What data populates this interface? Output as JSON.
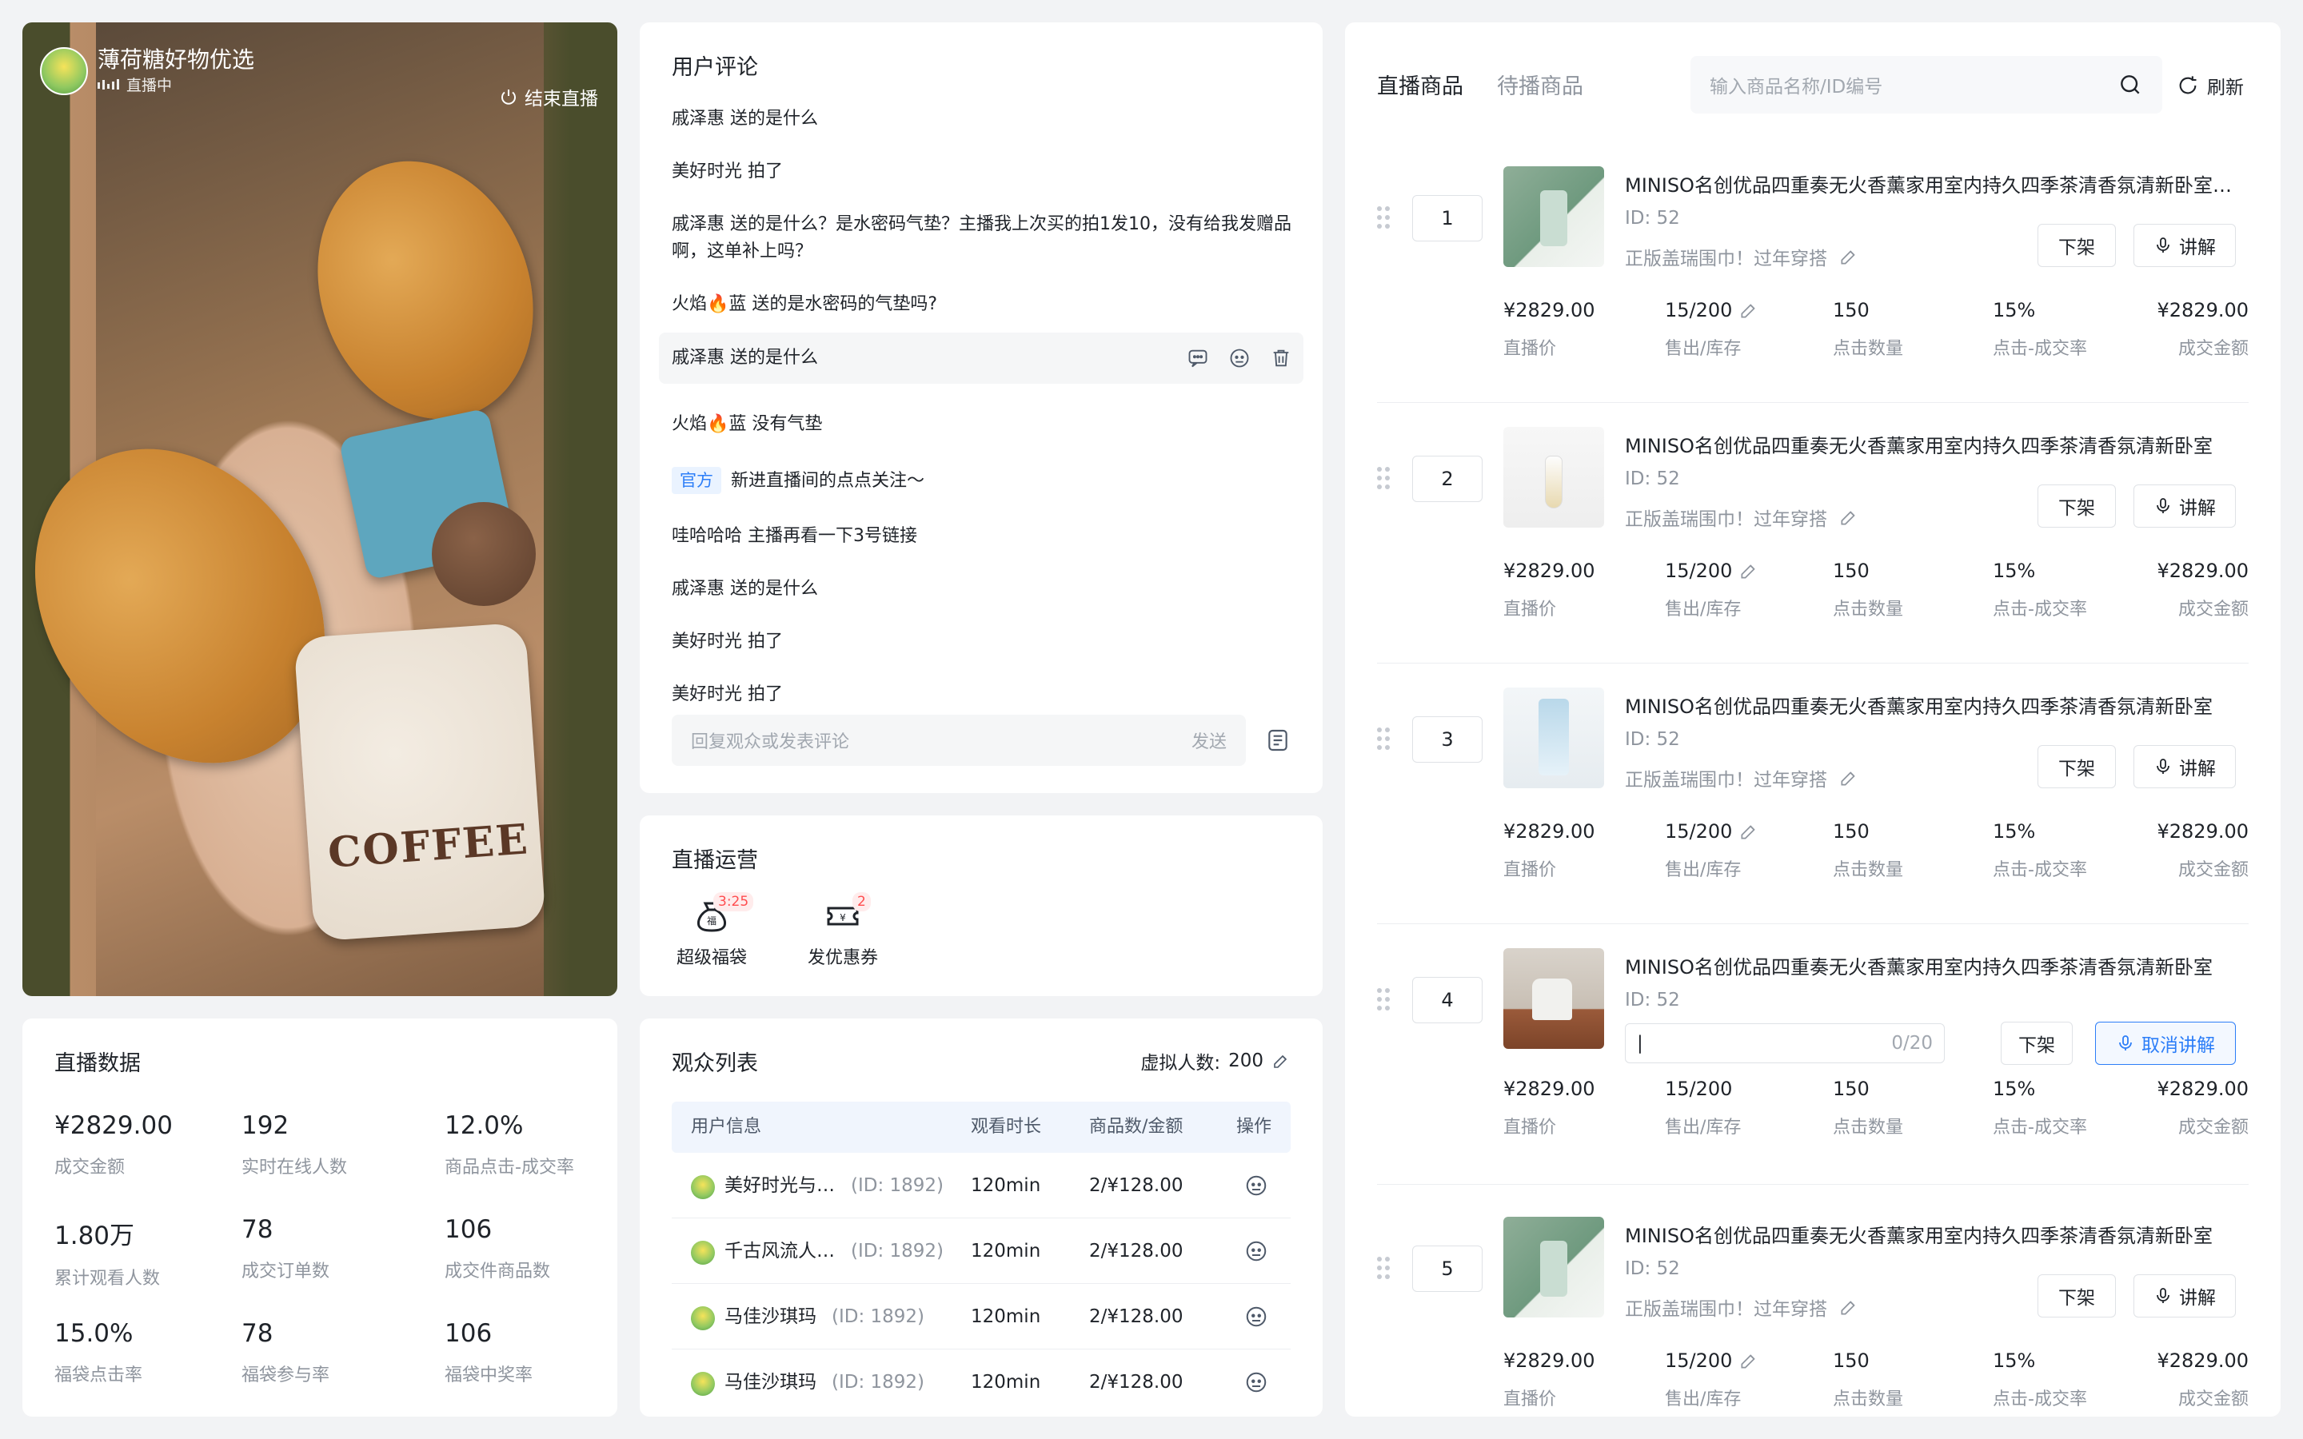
{
  "live": {
    "room_name": "薄荷糖好物优选",
    "status": "直播中",
    "end_label": "结束直播",
    "overlay_text": "COFFEE"
  },
  "live_data": {
    "title": "直播数据",
    "stats": [
      {
        "value": "¥2829.00",
        "label": "成交金额"
      },
      {
        "value": "192",
        "label": "实时在线人数"
      },
      {
        "value": "12.0%",
        "label": "商品点击-成交率"
      },
      {
        "value": "1.80万",
        "label": "累计观看人数"
      },
      {
        "value": "78",
        "label": "成交订单数"
      },
      {
        "value": "106",
        "label": "成交件商品数"
      },
      {
        "value": "15.0%",
        "label": "福袋点击率"
      },
      {
        "value": "78",
        "label": "福袋参与率"
      },
      {
        "value": "106",
        "label": "福袋中奖率"
      }
    ]
  },
  "comments": {
    "title": "用户评论",
    "items": [
      {
        "user": "戚泽惠",
        "text": "送的是什么"
      },
      {
        "user": "美好时光",
        "text": "拍了"
      },
      {
        "user": "戚泽惠",
        "text": "送的是什么？是水密码气垫？主播我上次买的拍1发10，没有给我发赠品啊，这单补上吗？"
      },
      {
        "user": "火焰🔥蓝",
        "text": "送的是水密码的气垫吗?"
      },
      {
        "user": "戚泽惠",
        "text": "送的是什么"
      },
      {
        "user": "火焰🔥蓝",
        "text": "没有气垫"
      },
      {
        "user": "官方",
        "text": "新进直播间的点点关注～"
      },
      {
        "user": "哇哈哈哈",
        "text": "主播再看一下3号链接"
      },
      {
        "user": "戚泽惠",
        "text": "送的是什么"
      },
      {
        "user": "美好时光",
        "text": "拍了"
      },
      {
        "user": "美好时光",
        "text": "拍了"
      }
    ],
    "reply_placeholder": "回复观众或发表评论",
    "send_label": "发送"
  },
  "operations": {
    "title": "直播运营",
    "items": [
      {
        "label": "超级福袋",
        "badge": "3:25"
      },
      {
        "label": "发优惠券",
        "badge": "2"
      }
    ]
  },
  "audience": {
    "title": "观众列表",
    "virtual_label": "虚拟人数:",
    "virtual_count": "200",
    "columns": [
      "用户信息",
      "观看时长",
      "商品数/金额",
      "操作"
    ],
    "rows": [
      {
        "name": "美好时光与…",
        "id": "(ID: 1892)",
        "duration": "120min",
        "amount": "2/¥128.00"
      },
      {
        "name": "千古风流人…",
        "id": "(ID: 1892)",
        "duration": "120min",
        "amount": "2/¥128.00"
      },
      {
        "name": "马佳沙琪玛",
        "id": "(ID: 1892)",
        "duration": "120min",
        "amount": "2/¥128.00"
      },
      {
        "name": "马佳沙琪玛",
        "id": "(ID: 1892)",
        "duration": "120min",
        "amount": "2/¥128.00"
      }
    ]
  },
  "products": {
    "tabs": [
      "直播商品",
      "待播商品"
    ],
    "search_placeholder": "输入商品名称/ID编号",
    "refresh_label": "刷新",
    "delist_label": "下架",
    "explain_label": "讲解",
    "cancel_explain_label": "取消讲解",
    "input_counter": "0/20",
    "metric_labels": [
      "直播价",
      "售出/库存",
      "点击数量",
      "点击-成交率",
      "成交金额"
    ],
    "items": [
      {
        "index": "1",
        "name": "MINISO名创优品四重奏无火香薰家用室内持久四季茶清香氛清新卧室四…",
        "id": "ID:  52",
        "desc": "正版盖瑞围巾！过年穿搭",
        "price": "¥2829.00",
        "stock": "15/200",
        "clicks": "150",
        "rate": "15%",
        "revenue": "¥2829.00"
      },
      {
        "index": "2",
        "name": "MINISO名创优品四重奏无火香薰家用室内持久四季茶清香氛清新卧室",
        "id": "ID:  52",
        "desc": "正版盖瑞围巾！过年穿搭",
        "price": "¥2829.00",
        "stock": "15/200",
        "clicks": "150",
        "rate": "15%",
        "revenue": "¥2829.00"
      },
      {
        "index": "3",
        "name": "MINISO名创优品四重奏无火香薰家用室内持久四季茶清香氛清新卧室",
        "id": "ID:  52",
        "desc": "正版盖瑞围巾！过年穿搭",
        "price": "¥2829.00",
        "stock": "15/200",
        "clicks": "150",
        "rate": "15%",
        "revenue": "¥2829.00"
      },
      {
        "index": "4",
        "name": "MINISO名创优品四重奏无火香薰家用室内持久四季茶清香氛清新卧室",
        "id": "ID:  52",
        "desc": "",
        "price": "¥2829.00",
        "stock": "15/200",
        "clicks": "150",
        "rate": "15%",
        "revenue": "¥2829.00"
      },
      {
        "index": "5",
        "name": "MINISO名创优品四重奏无火香薰家用室内持久四季茶清香氛清新卧室",
        "id": "ID:  52",
        "desc": "正版盖瑞围巾！过年穿搭",
        "price": "¥2829.00",
        "stock": "15/200",
        "clicks": "150",
        "rate": "15%",
        "revenue": "¥2829.00"
      }
    ]
  },
  "colors": {
    "accent": "#2c7ef8",
    "badge_red": "#ff4d4f",
    "background": "#f2f3f5"
  }
}
